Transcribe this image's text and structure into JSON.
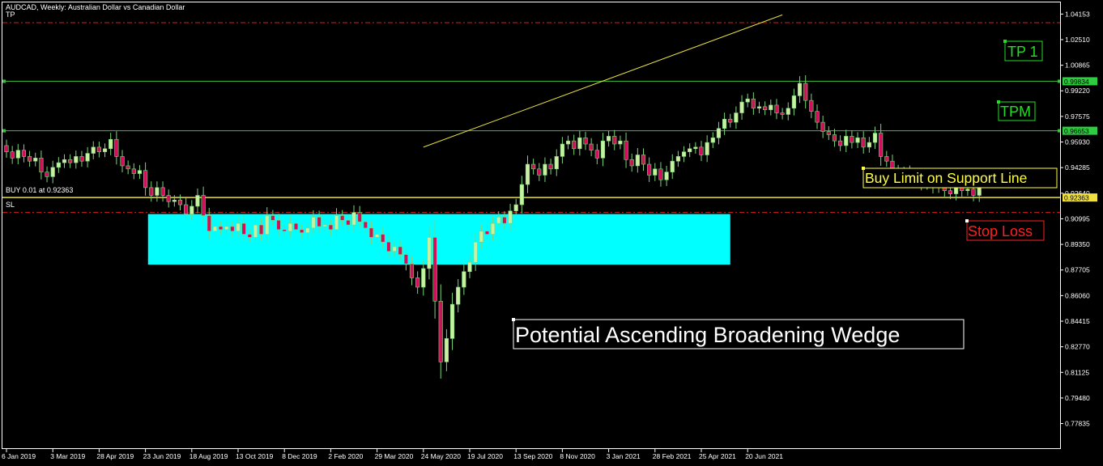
{
  "chart_header": {
    "title": "AUDCAD, Weekly:  Australian Dollar vs Canadian Dollar",
    "tp_label": "TP",
    "sl_label": "SL",
    "buy_label": "BUY 0.01 at 0.92363"
  },
  "annotations": {
    "tp1": "TP 1",
    "tpm": "TPM",
    "buy_limit": "Buy Limit on Support Line",
    "stop_loss": "Stop Loss",
    "wedge": "Potential Ascending Broadening Wedge"
  },
  "colors": {
    "background": "#000000",
    "bull_candle": "#c8f0a0",
    "bear_candle": "#d0105a",
    "wick": "#7bd47b",
    "zone": "#00ffff",
    "level_line": "#3fbf3f",
    "buy_line": "#e8e040",
    "dashed_red": "#d02020",
    "price_tag_green": "#2ecc40",
    "price_tag_yellow": "#f0e040",
    "tp_text": "#22dd22",
    "sl_text": "#ff2020",
    "yellow_text": "#ffff40"
  },
  "chart_data": {
    "type": "candlestick",
    "symbol": "AUDCAD",
    "timeframe": "Weekly",
    "ylim": [
      0.762,
      1.049
    ],
    "y_ticks": [
      "1.04153",
      "1.02510",
      "1.00865",
      "0.99220",
      "0.97575",
      "0.95930",
      "0.94285",
      "0.92640",
      "0.90995",
      "0.89350",
      "0.87705",
      "0.86060",
      "0.84415",
      "0.82770",
      "0.81125",
      "0.79480",
      "0.77835"
    ],
    "x_ticks": [
      "6 Jan 2019",
      "3 Mar 2019",
      "28 Apr 2019",
      "23 Jun 2019",
      "18 Aug 2019",
      "13 Oct 2019",
      "8 Dec 2019",
      "2 Feb 2020",
      "29 Mar 2020",
      "24 May 2020",
      "19 Jul 2020",
      "13 Sep 2020",
      "8 Nov 2020",
      "3 Jan 2021",
      "28 Feb 2021",
      "25 Apr 2021",
      "20 Jun 2021"
    ],
    "levels": {
      "tp": 1.036,
      "tp1": 0.99834,
      "tpm": 0.96653,
      "buy": 0.92363,
      "sl": 0.914
    },
    "price_tags": {
      "tp1": "0.99834",
      "tpm": "0.96653",
      "buy": "0.92363"
    },
    "trendline": {
      "start": [
        "2020-05-24",
        0.956
      ],
      "end": [
        "2021-08-01",
        1.041
      ]
    },
    "zone": {
      "start": "2019-06-30",
      "end": "2021-05-30",
      "high": 0.913,
      "low": 0.8805
    },
    "closes": [
      0.953,
      0.949,
      0.954,
      0.95,
      0.947,
      0.949,
      0.94,
      0.937,
      0.943,
      0.946,
      0.948,
      0.946,
      0.95,
      0.947,
      0.952,
      0.956,
      0.953,
      0.955,
      0.961,
      0.95,
      0.944,
      0.942,
      0.939,
      0.941,
      0.93,
      0.925,
      0.93,
      0.925,
      0.921,
      0.922,
      0.919,
      0.913,
      0.918,
      0.925,
      0.912,
      0.902,
      0.905,
      0.903,
      0.905,
      0.902,
      0.907,
      0.9,
      0.898,
      0.906,
      0.9,
      0.912,
      0.909,
      0.903,
      0.902,
      0.907,
      0.903,
      0.901,
      0.904,
      0.911,
      0.905,
      0.906,
      0.903,
      0.912,
      0.909,
      0.906,
      0.914,
      0.908,
      0.904,
      0.898,
      0.9,
      0.895,
      0.889,
      0.892,
      0.887,
      0.881,
      0.872,
      0.866,
      0.878,
      0.898,
      0.857,
      0.818,
      0.833,
      0.855,
      0.866,
      0.876,
      0.882,
      0.895,
      0.902,
      0.9,
      0.907,
      0.911,
      0.907,
      0.915,
      0.919,
      0.932,
      0.945,
      0.942,
      0.938,
      0.945,
      0.942,
      0.95,
      0.958,
      0.96,
      0.955,
      0.962,
      0.958,
      0.954,
      0.949,
      0.96,
      0.963,
      0.958,
      0.96,
      0.948,
      0.944,
      0.951,
      0.945,
      0.938,
      0.942,
      0.935,
      0.94,
      0.947,
      0.95,
      0.953,
      0.955,
      0.956,
      0.951,
      0.959,
      0.962,
      0.968,
      0.974,
      0.972,
      0.978,
      0.985,
      0.987,
      0.981,
      0.982,
      0.98,
      0.983,
      0.978,
      0.977,
      0.981,
      0.989,
      0.997,
      0.986,
      0.979,
      0.972,
      0.966,
      0.964,
      0.96,
      0.957,
      0.963,
      0.959,
      0.962,
      0.956,
      0.959,
      0.965,
      0.95,
      0.947,
      0.941,
      0.938,
      0.94,
      0.934,
      0.936,
      0.932,
      0.934,
      0.93,
      0.932,
      0.928,
      0.926,
      0.932,
      0.928,
      0.929,
      0.925,
      0.931
    ]
  }
}
